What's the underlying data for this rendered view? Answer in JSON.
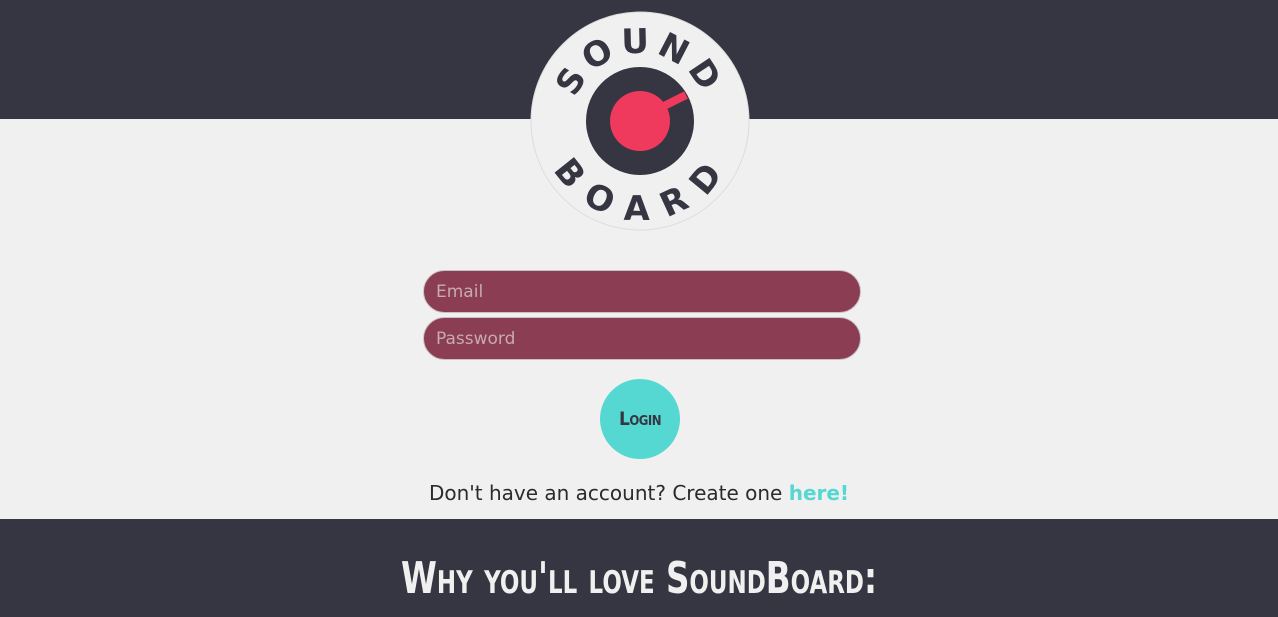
{
  "brand": {
    "logo_text_top": "SOUND",
    "logo_text_bottom": "BOARD",
    "logo_icon": "record-icon"
  },
  "login_form": {
    "email": {
      "placeholder": "Email",
      "value": ""
    },
    "password": {
      "placeholder": "Password",
      "value": ""
    },
    "login_label": "Login"
  },
  "signup": {
    "prompt": "Don't have an account? Create one ",
    "link_label": "here!"
  },
  "features": {
    "heading": "Why you'll love SoundBoard:"
  },
  "colors": {
    "dark_band": "#353641",
    "background": "#f0f0f0",
    "input_fill": "#8a3d53",
    "accent_teal": "#55d8d1",
    "accent_red": "#ef3a5d"
  }
}
